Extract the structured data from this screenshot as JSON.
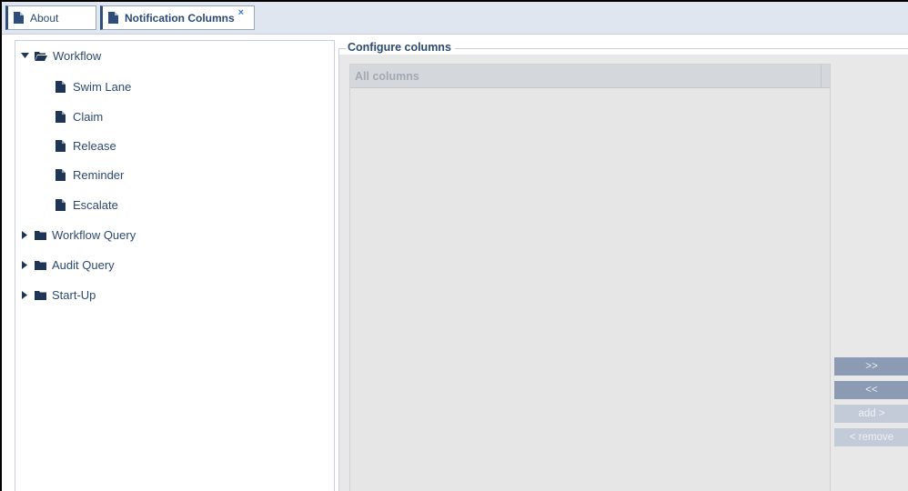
{
  "tabs": [
    {
      "label": "About",
      "icon": "document-icon",
      "active": false
    },
    {
      "label": "Notification Columns",
      "icon": "document-icon",
      "active": true,
      "close": "×"
    }
  ],
  "tree": {
    "nodes": [
      {
        "label": "Workflow",
        "expanded": true,
        "icon": "folder-open-icon"
      },
      {
        "label": "Swim Lane",
        "icon": "document-icon"
      },
      {
        "label": "Claim",
        "icon": "document-icon"
      },
      {
        "label": "Release",
        "icon": "document-icon"
      },
      {
        "label": "Reminder",
        "icon": "document-icon"
      },
      {
        "label": "Escalate",
        "icon": "document-icon"
      },
      {
        "label": "Workflow Query",
        "expanded": false,
        "icon": "folder-icon"
      },
      {
        "label": "Audit Query",
        "expanded": false,
        "icon": "folder-icon"
      },
      {
        "label": "Start-Up",
        "expanded": false,
        "icon": "folder-icon"
      }
    ]
  },
  "configure": {
    "legend": "Configure columns",
    "all_columns_header": "All columns",
    "buttons": {
      "add_all": ">>",
      "remove_all": "<<",
      "add": "add >",
      "remove": "< remove"
    }
  },
  "colors": {
    "accent": "#2b4a72",
    "tab_bar": "#dfe6ef",
    "button_active": "#8b9bb4",
    "button_disabled": "#c3cbd8"
  }
}
